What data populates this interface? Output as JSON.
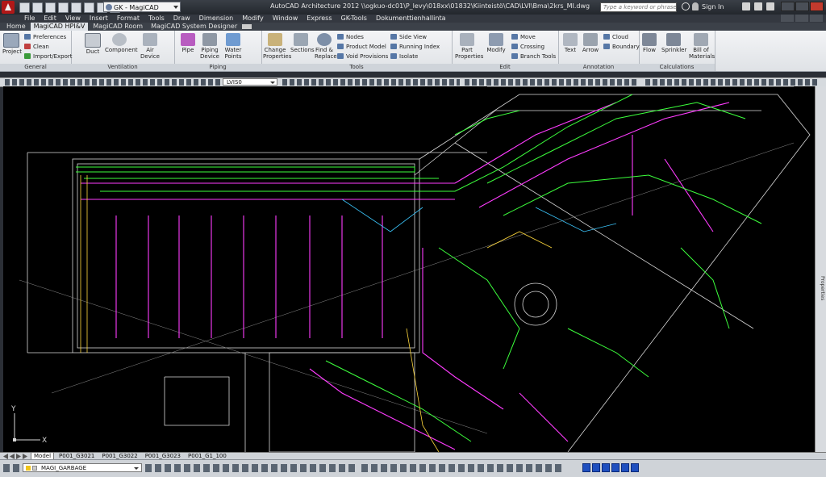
{
  "titlebar": {
    "workspace": "GK - MagiCAD",
    "window_title": "AutoCAD Architecture 2012   \\\\ogkuo-dc01\\P_levy\\018xx\\01832\\Kiinteistö\\CAD\\LVI\\Bma\\2krs_MI.dwg",
    "search_placeholder": "Type a keyword or phrase",
    "sign_in": "Sign In"
  },
  "menu": [
    "File",
    "Edit",
    "View",
    "Insert",
    "Format",
    "Tools",
    "Draw",
    "Dimension",
    "Modify",
    "Window",
    "Express",
    "GK-Tools",
    "Dokumenttienhallinta"
  ],
  "tabs": [
    "Home",
    "MagiCAD HPI&V",
    "MagiCAD Room",
    "MagiCAD System Designer"
  ],
  "ribbon": {
    "general": {
      "label": "General",
      "project": "Project",
      "preferences": "Preferences",
      "clean": "Clean",
      "import_export": "Import/Export"
    },
    "ventilation": {
      "label": "Ventilation",
      "duct": "Duct",
      "component": "Component",
      "air_device": "Air Device"
    },
    "piping": {
      "label": "Piping",
      "pipe": "Pipe",
      "piping_device": "Piping Device",
      "water_points": "Water Points"
    },
    "tools": {
      "label": "Tools",
      "change_properties": "Change Properties",
      "sections": "Sections",
      "find_replace": "Find & Replace",
      "nodes": "Nodes",
      "product_model": "Product Model",
      "void_provisions": "Void Provisions",
      "side_view": "Side View",
      "running_index": "Running Index",
      "isolate": "Isolate"
    },
    "edit": {
      "label": "Edit",
      "part_properties": "Part Properties",
      "modify": "Modify",
      "move": "Move",
      "crossing": "Crossing",
      "branch_tools": "Branch Tools"
    },
    "annotation": {
      "label": "Annotation",
      "text": "Text",
      "arrow": "Arrow",
      "cloud": "Cloud",
      "boundary": "Boundary"
    },
    "calculations": {
      "label": "Calculations",
      "flow": "Flow",
      "sprinkler": "Sprinkler",
      "bill_of_materials": "Bill of Materials"
    }
  },
  "toolbar": {
    "layer_combo": "LVIS0"
  },
  "canvas": {
    "ucs_y": "Y",
    "ucs_x": "X"
  },
  "right_palette": "Properties",
  "layout_tabs": [
    "Model",
    "P001_G3021",
    "P001_G3022",
    "P001_G3023",
    "P001_G1_100"
  ],
  "status": {
    "layer": "MAGI_GARBAGE"
  },
  "colors": {
    "title_bg": "#23272d",
    "ribbon_bg": "#e6e8eb",
    "canvas_bg": "#000000",
    "cad_green": "#3cff3c",
    "cad_magenta": "#ff3cff",
    "cad_white": "#d8d8d8"
  }
}
